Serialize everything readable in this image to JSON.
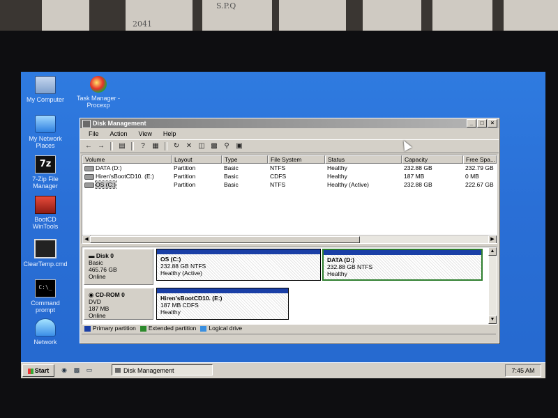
{
  "background_papers": [
    "2041",
    "S.P.Q"
  ],
  "desktop": {
    "icons": [
      {
        "label": "My Computer",
        "icon": "my-computer-icon"
      },
      {
        "label": "Task Manager - Procexp",
        "icon": "task-manager-procexp-icon"
      },
      {
        "label": "My Network Places",
        "icon": "my-network-places-icon"
      },
      {
        "label": "7-Zip File Manager",
        "icon": "7zip-icon",
        "glyph": "7z"
      },
      {
        "label": "BootCD WinTools",
        "icon": "bootcd-wintools-icon"
      },
      {
        "label": "ClearTemp.cmd",
        "icon": "cleartemp-icon"
      },
      {
        "label": "Command prompt",
        "icon": "command-prompt-icon",
        "glyph": "C:\\_"
      },
      {
        "label": "Network",
        "icon": "network-icon"
      }
    ]
  },
  "window": {
    "title": "Disk Management",
    "buttons": [
      "_",
      "□",
      "×"
    ],
    "menu": [
      "File",
      "Action",
      "View",
      "Help"
    ],
    "toolbar": [
      "back-arrow-icon",
      "forward-arrow-icon",
      "view-icon",
      "help-icon",
      "properties-icon",
      "refresh-icon",
      "delete-icon",
      "disk-icon",
      "drive-icon",
      "search-icon",
      "export-icon"
    ]
  },
  "volumes": {
    "columns": [
      "Volume",
      "Layout",
      "Type",
      "File System",
      "Status",
      "Capacity",
      "Free Spa..."
    ],
    "rows": [
      {
        "volume": "DATA (D:)",
        "layout": "Partition",
        "type": "Basic",
        "fs": "NTFS",
        "status": "Healthy",
        "capacity": "232.88 GB",
        "free": "232.79 GB",
        "selected": false
      },
      {
        "volume": "Hiren'sBootCD10. (E:)",
        "layout": "Partition",
        "type": "Basic",
        "fs": "CDFS",
        "status": "Healthy",
        "capacity": "187 MB",
        "free": "0 MB",
        "selected": false
      },
      {
        "volume": "OS (C:)",
        "layout": "Partition",
        "type": "Basic",
        "fs": "NTFS",
        "status": "Healthy (Active)",
        "capacity": "232.88 GB",
        "free": "222.67 GB",
        "selected": true
      }
    ]
  },
  "disks": [
    {
      "name": "Disk 0",
      "kind": "Basic",
      "size": "465.76 GB",
      "state": "Online",
      "partitions": [
        {
          "name": "OS  (C:)",
          "detail": "232.88 GB NTFS",
          "status": "Healthy (Active)",
          "selected": false
        },
        {
          "name": "DATA  (D:)",
          "detail": "232.88 GB NTFS",
          "status": "Healthy",
          "selected": true
        }
      ]
    },
    {
      "name": "CD-ROM 0",
      "kind": "DVD",
      "size": "187 MB",
      "state": "Online",
      "partitions": [
        {
          "name": "Hiren'sBootCD10.  (E:)",
          "detail": "187 MB CDFS",
          "status": "Healthy",
          "selected": false
        }
      ]
    }
  ],
  "legend": [
    {
      "label": "Primary partition",
      "color": "#1a3fa6"
    },
    {
      "label": "Extended partition",
      "color": "#2c8a2c"
    },
    {
      "label": "Logical drive",
      "color": "#3a8fe0"
    }
  ],
  "taskbar": {
    "start": "Start",
    "quick_launch": [
      "browser-icon",
      "cmd-icon",
      "folder-icon"
    ],
    "task": "Disk Management",
    "clock": "7:45 AM"
  }
}
